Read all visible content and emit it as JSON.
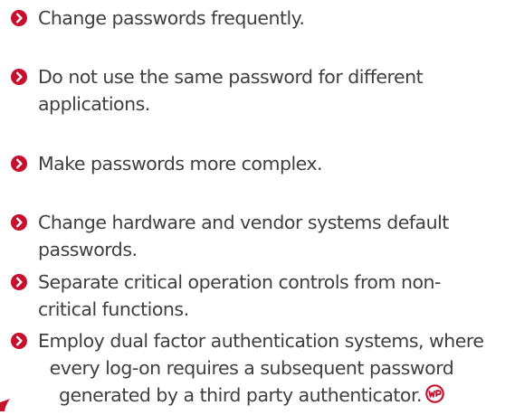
{
  "colors": {
    "accent": "#c8102e",
    "text": "#3f3f3f",
    "background": "#ffffff"
  },
  "bullet_icon": "chevron-right-circle-icon",
  "end_icon": "wp-logo-icon",
  "items": [
    {
      "lines": [
        "Change passwords frequently."
      ]
    },
    {
      "lines": [
        "Do not use the same password for different",
        "applications."
      ]
    },
    {
      "lines": [
        "Make passwords more complex."
      ]
    },
    {
      "lines": [
        "Change hardware and vendor systems default",
        "passwords."
      ]
    },
    {
      "lines": [
        "Separate critical operation controls from non-",
        "critical functions."
      ]
    },
    {
      "lines": [
        "Employ dual factor authentication systems, where",
        "every log-on requires a subsequent password",
        "generated by a third party authenticator."
      ]
    }
  ]
}
